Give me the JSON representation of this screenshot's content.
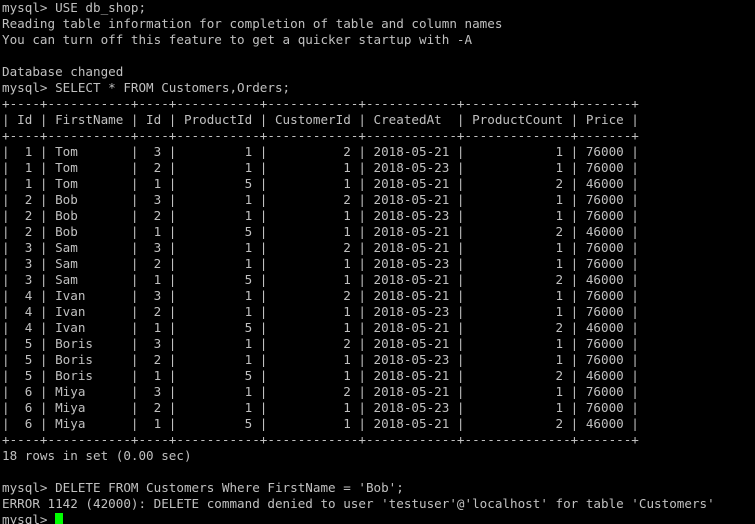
{
  "terminal": {
    "colors": {
      "background": "#000000",
      "text": "#c0c0c0",
      "cursor": "#00ff00"
    },
    "lines": [
      "mysql> USE db_shop;",
      "Reading table information for completion of table and column names",
      "You can turn off this feature to get a quicker startup with -A",
      "",
      "Database changed",
      "mysql> SELECT * FROM Customers,Orders;",
      "+----+-----------+----+-----------+------------+------------+--------------+-------+",
      "| Id | FirstName | Id | ProductId | CustomerId | CreatedAt  | ProductCount | Price |",
      "+----+-----------+----+-----------+------------+------------+--------------+-------+",
      "|  1 | Tom       |  3 |         1 |          2 | 2018-05-21 |            1 | 76000 |",
      "|  1 | Tom       |  2 |         1 |          1 | 2018-05-23 |            1 | 76000 |",
      "|  1 | Tom       |  1 |         5 |          1 | 2018-05-21 |            2 | 46000 |",
      "|  2 | Bob       |  3 |         1 |          2 | 2018-05-21 |            1 | 76000 |",
      "|  2 | Bob       |  2 |         1 |          1 | 2018-05-23 |            1 | 76000 |",
      "|  2 | Bob       |  1 |         5 |          1 | 2018-05-21 |            2 | 46000 |",
      "|  3 | Sam       |  3 |         1 |          2 | 2018-05-21 |            1 | 76000 |",
      "|  3 | Sam       |  2 |         1 |          1 | 2018-05-23 |            1 | 76000 |",
      "|  3 | Sam       |  1 |         5 |          1 | 2018-05-21 |            2 | 46000 |",
      "|  4 | Ivan      |  3 |         1 |          2 | 2018-05-21 |            1 | 76000 |",
      "|  4 | Ivan      |  2 |         1 |          1 | 2018-05-23 |            1 | 76000 |",
      "|  4 | Ivan      |  1 |         5 |          1 | 2018-05-21 |            2 | 46000 |",
      "|  5 | Boris     |  3 |         1 |          2 | 2018-05-21 |            1 | 76000 |",
      "|  5 | Boris     |  2 |         1 |          1 | 2018-05-23 |            1 | 76000 |",
      "|  5 | Boris     |  1 |         5 |          1 | 2018-05-21 |            2 | 46000 |",
      "|  6 | Miya      |  3 |         1 |          2 | 2018-05-21 |            1 | 76000 |",
      "|  6 | Miya      |  2 |         1 |          1 | 2018-05-23 |            1 | 76000 |",
      "|  6 | Miya      |  1 |         5 |          1 | 2018-05-21 |            2 | 46000 |",
      "+----+-----------+----+-----------+------------+------------+--------------+-------+",
      "18 rows in set (0.00 sec)",
      "",
      "mysql> DELETE FROM Customers Where FirstName = 'Bob';",
      "ERROR 1142 (42000): DELETE command denied to user 'testuser'@'localhost' for table 'Customers'"
    ],
    "prompt": "mysql> "
  }
}
